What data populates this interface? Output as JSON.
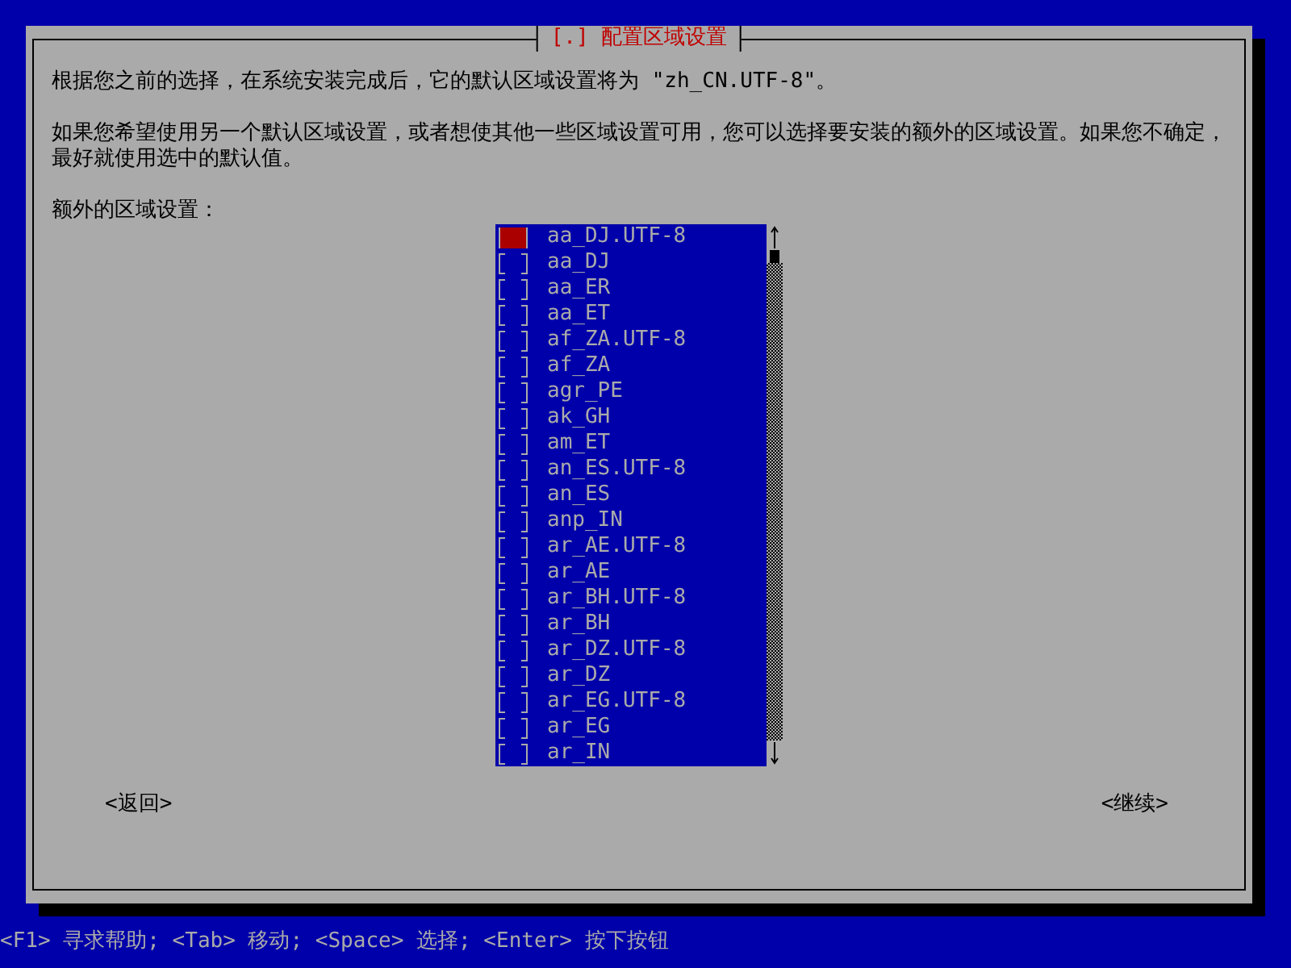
{
  "dialog": {
    "title": "[.] 配置区域设置",
    "paragraphs": [
      "根据您之前的选择，在系统安装完成后，它的默认区域设置将为 \"zh_CN.UTF-8\"。",
      "如果您希望使用另一个默认区域设置，或者想使其他一些区域设置可用，您可以选择要安装的额外的区域设置。如果您不确定，最好就使用选中的默认值。"
    ],
    "list_label": "额外的区域设置：",
    "locales": [
      {
        "label": "aa_DJ.UTF-8",
        "checked": false,
        "focused": true
      },
      {
        "label": "aa_DJ",
        "checked": false,
        "focused": false
      },
      {
        "label": "aa_ER",
        "checked": false,
        "focused": false
      },
      {
        "label": "aa_ET",
        "checked": false,
        "focused": false
      },
      {
        "label": "af_ZA.UTF-8",
        "checked": false,
        "focused": false
      },
      {
        "label": "af_ZA",
        "checked": false,
        "focused": false
      },
      {
        "label": "agr_PE",
        "checked": false,
        "focused": false
      },
      {
        "label": "ak_GH",
        "checked": false,
        "focused": false
      },
      {
        "label": "am_ET",
        "checked": false,
        "focused": false
      },
      {
        "label": "an_ES.UTF-8",
        "checked": false,
        "focused": false
      },
      {
        "label": "an_ES",
        "checked": false,
        "focused": false
      },
      {
        "label": "anp_IN",
        "checked": false,
        "focused": false
      },
      {
        "label": "ar_AE.UTF-8",
        "checked": false,
        "focused": false
      },
      {
        "label": "ar_AE",
        "checked": false,
        "focused": false
      },
      {
        "label": "ar_BH.UTF-8",
        "checked": false,
        "focused": false
      },
      {
        "label": "ar_BH",
        "checked": false,
        "focused": false
      },
      {
        "label": "ar_DZ.UTF-8",
        "checked": false,
        "focused": false
      },
      {
        "label": "ar_DZ",
        "checked": false,
        "focused": false
      },
      {
        "label": "ar_EG.UTF-8",
        "checked": false,
        "focused": false
      },
      {
        "label": "ar_EG",
        "checked": false,
        "focused": false
      },
      {
        "label": "ar_IN",
        "checked": false,
        "focused": false
      }
    ],
    "buttons": [
      "<返回>",
      "<继续>"
    ]
  },
  "status_bar": "<F1> 寻求帮助; <Tab> 移动; <Space> 选择; <Enter> 按下按钮"
}
